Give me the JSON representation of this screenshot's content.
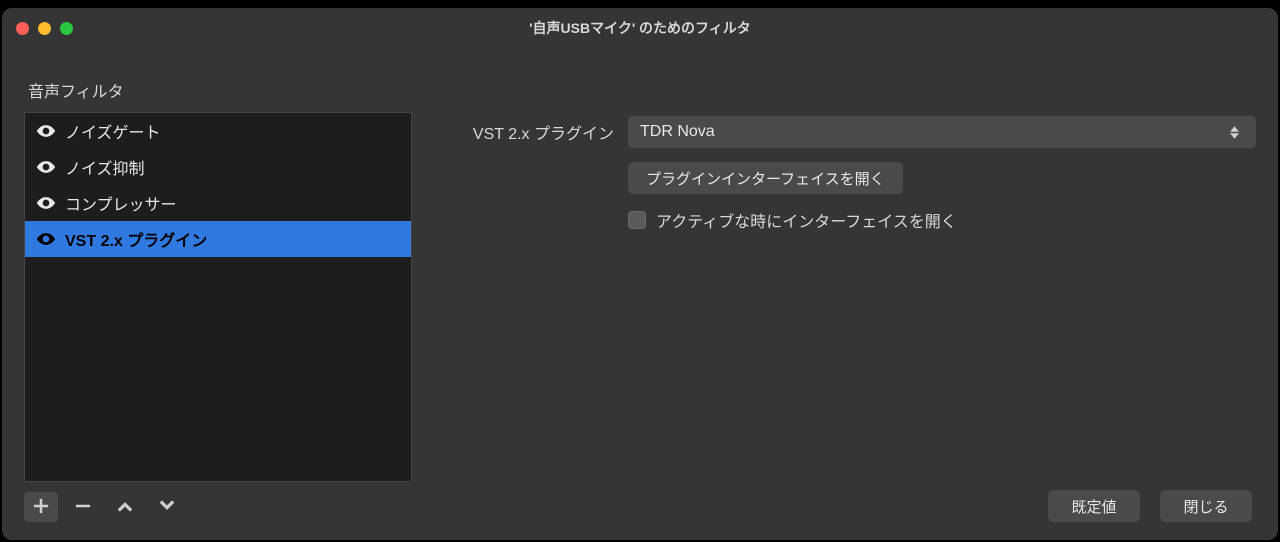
{
  "window": {
    "title": "'自声USBマイク' のためのフィルタ"
  },
  "sidebar": {
    "heading": "音声フィルタ",
    "items": [
      {
        "label": "ノイズゲート",
        "selected": false
      },
      {
        "label": "ノイズ抑制",
        "selected": false
      },
      {
        "label": "コンプレッサー",
        "selected": false
      },
      {
        "label": "VST 2.x プラグイン",
        "selected": true
      }
    ]
  },
  "detail": {
    "plugin_type_label": "VST 2.x プラグイン",
    "plugin_selected": "TDR Nova",
    "open_interface_button": "プラグインインターフェイスを開く",
    "auto_open_checkbox_label": "アクティブな時にインターフェイスを開く",
    "auto_open_checked": false
  },
  "footer": {
    "defaults_button": "既定値",
    "close_button": "閉じる"
  }
}
